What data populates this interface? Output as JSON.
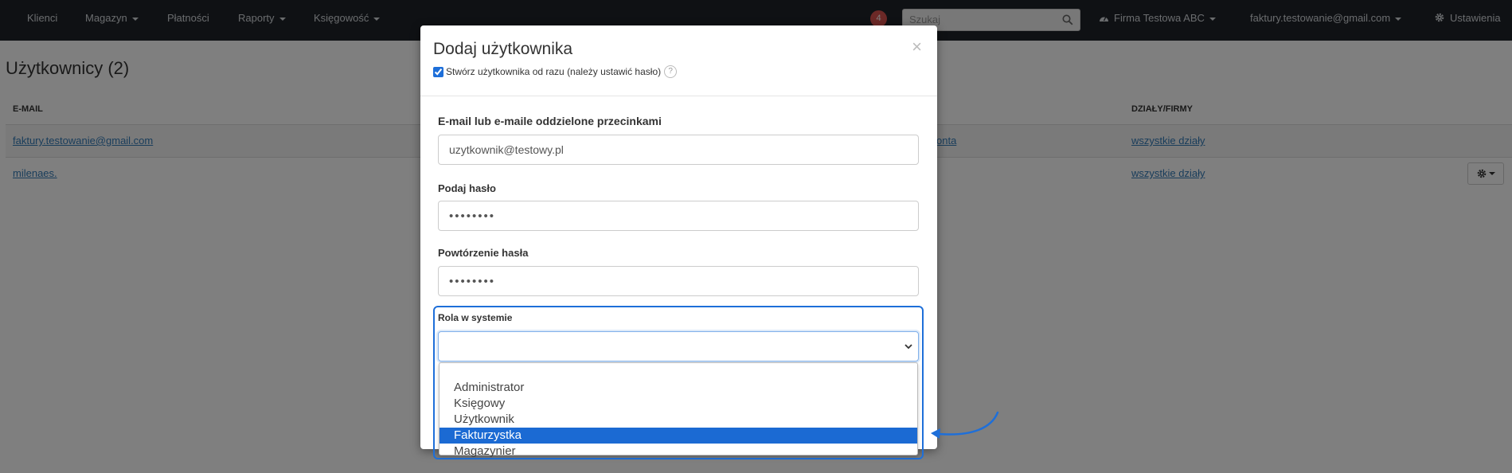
{
  "navbar": {
    "items": [
      {
        "label": "Klienci",
        "dropdown": false
      },
      {
        "label": "Magazyn",
        "dropdown": true
      },
      {
        "label": "Płatności",
        "dropdown": false
      },
      {
        "label": "Raporty",
        "dropdown": true
      },
      {
        "label": "Księgowość",
        "dropdown": true
      }
    ],
    "notification_count": "4",
    "search_placeholder": "Szukaj",
    "company": "Firma Testowa ABC",
    "account_email": "faktury.testowanie@gmail.com",
    "settings_label": "Ustawienia"
  },
  "page": {
    "title": "Użytkownicy (2)",
    "columns": [
      "E-MAIL",
      "DZIAŁY/FIRMY"
    ],
    "rows": [
      {
        "email": "faktury.testowanie@gmail.com",
        "partial": "onta",
        "departments": "wszystkie działy"
      },
      {
        "email": "milenaes.",
        "departments": "wszystkie działy"
      }
    ]
  },
  "modal": {
    "title": "Dodaj użytkownika",
    "close": "×",
    "create_now_label": "Stwórz użytkownika od razu (należy ustawić hasło)",
    "help": "?",
    "email_label": "E-mail lub e-maile oddzielone przecinkami",
    "email_value": "uzytkownik@testowy.pl",
    "password_label": "Podaj hasło",
    "password_value": "••••••••",
    "password_repeat_label": "Powtórzenie hasła",
    "password_repeat_value": "••••••••",
    "role_label": "Rola w systemie",
    "role_selected": "",
    "role_options": [
      "Administrator",
      "Księgowy",
      "Użytkownik",
      "Fakturzystka",
      "Magazynier"
    ],
    "highlighted_option": "Fakturzystka"
  },
  "colors": {
    "navbar": "#1f2328",
    "accent": "#1e6fd9",
    "highlight": "#1b6ad3",
    "link": "#337ab7",
    "badge": "#d9534f"
  }
}
